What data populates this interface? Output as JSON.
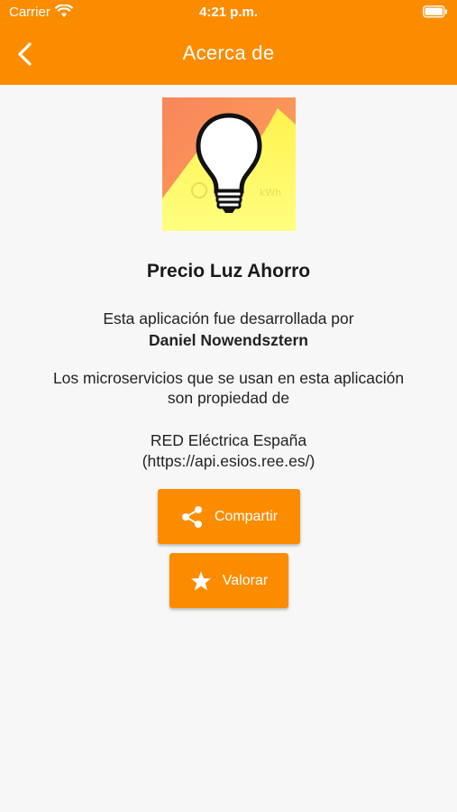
{
  "status_bar": {
    "carrier": "Carrier",
    "time": "4:21 p.m."
  },
  "header": {
    "title": "Acerca de",
    "background": "#fb8c00"
  },
  "app": {
    "name": "Precio Luz Ahorro",
    "developed_by_label": "Esta aplicación fue desarrollada por",
    "developer": "Daniel Nowendsztern",
    "services_line1": "Los microservicios que se usan en esta aplicación",
    "services_line2": "son propiedad de",
    "owner": "RED Eléctrica España",
    "owner_url": "(https://api.esios.ree.es/)"
  },
  "buttons": {
    "share_label": "Compartir",
    "rate_label": "Valorar"
  },
  "icons": {
    "back": "chevron-left-icon",
    "share": "share-icon",
    "rate": "star-icon"
  }
}
